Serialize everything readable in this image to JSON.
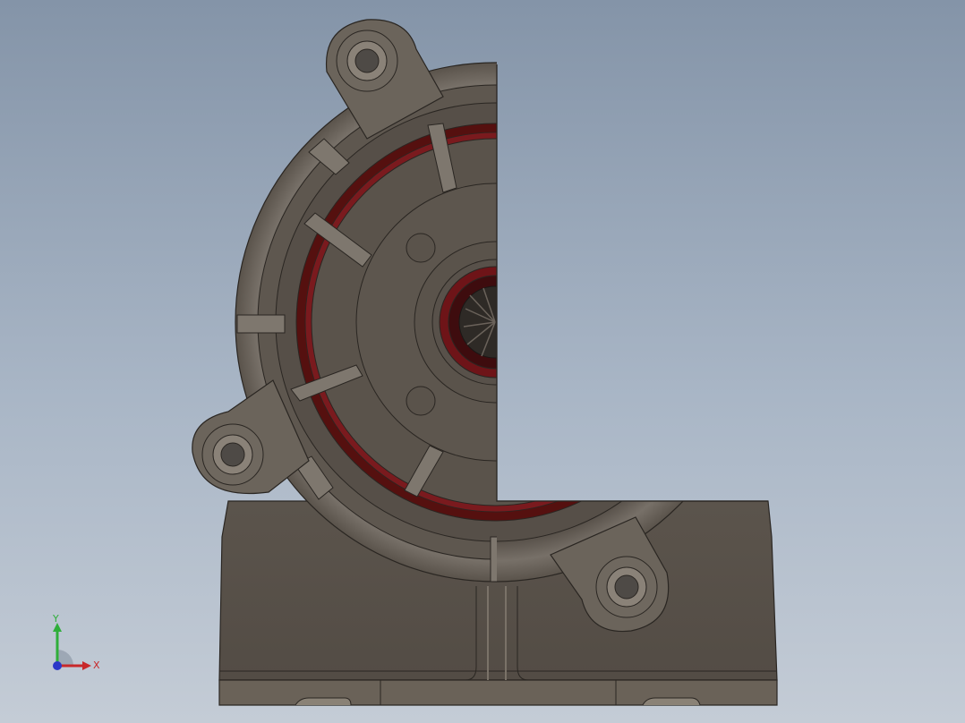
{
  "viewport": {
    "background_top": "#8494a8",
    "background_bottom": "#c4ccd6"
  },
  "model": {
    "body_color": "#5a534b",
    "accent_color": "#6e1418",
    "edge_color": "#2a2622"
  },
  "triad": {
    "x_label": "X",
    "y_label": "Y",
    "x_color": "#c8282a",
    "y_color": "#2fae3a",
    "z_color": "#2b38c8"
  }
}
